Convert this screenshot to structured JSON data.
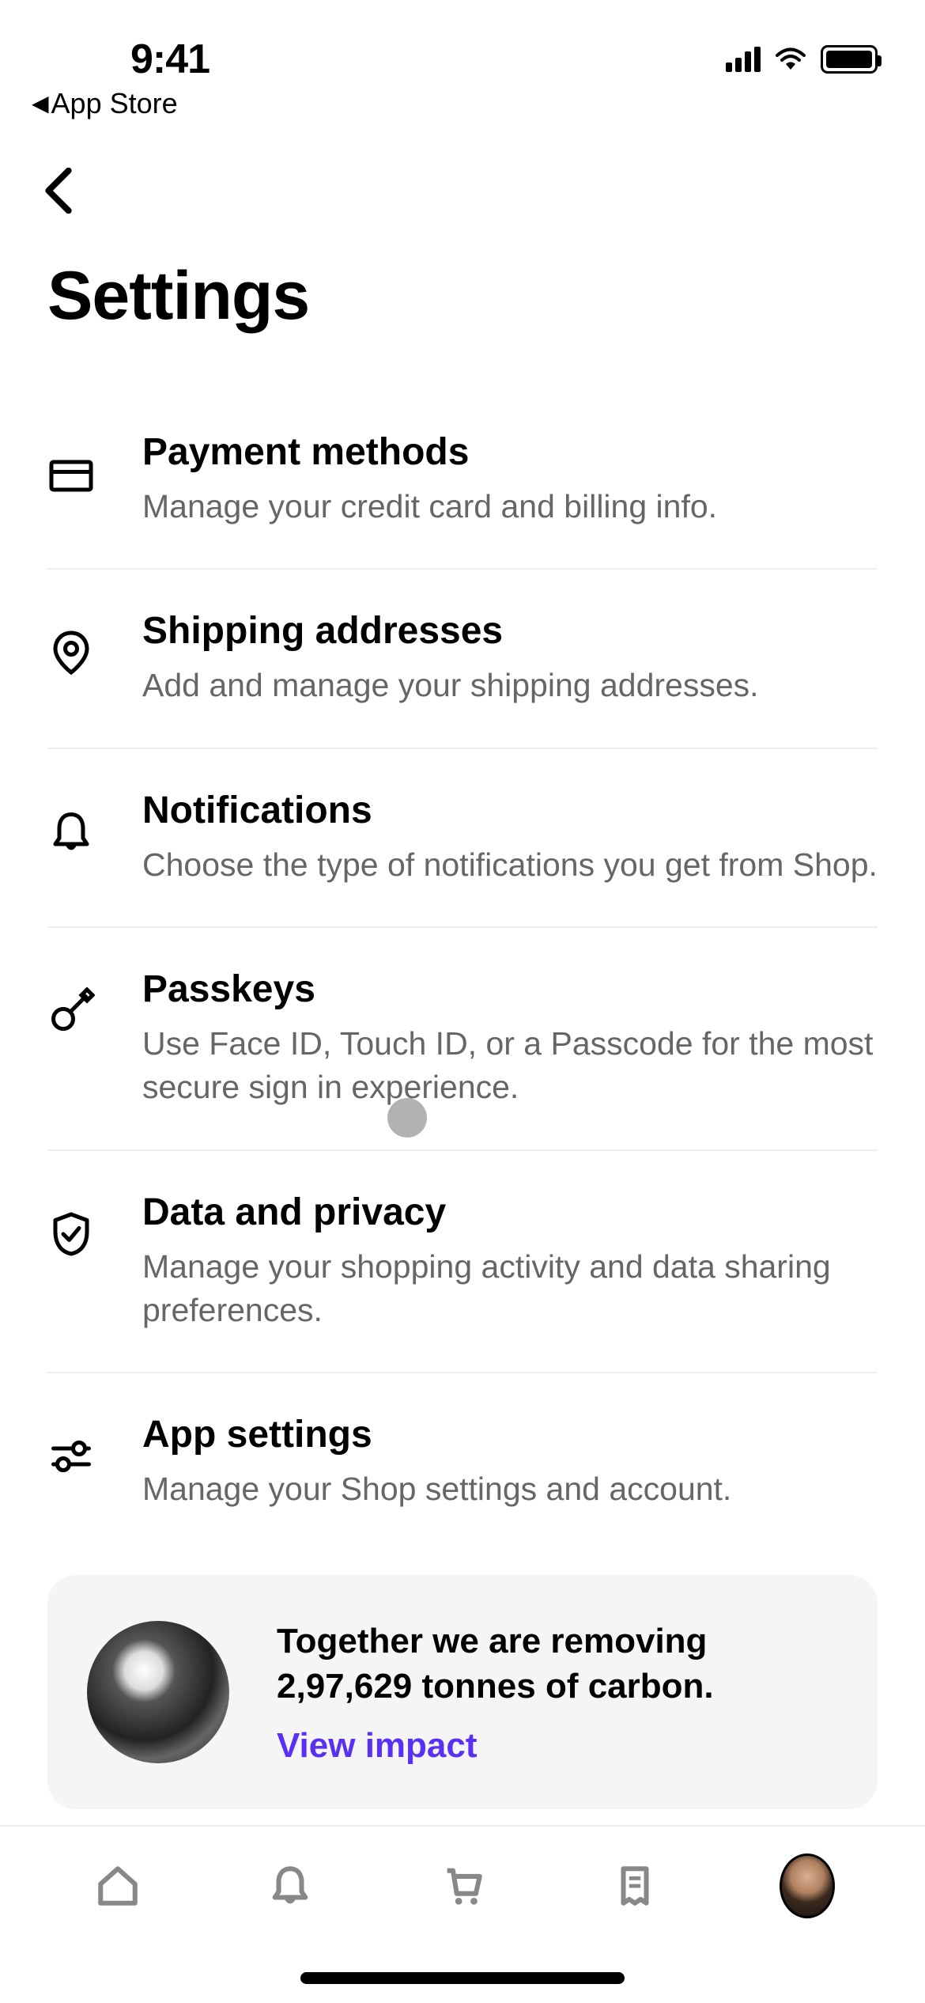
{
  "status": {
    "time": "9:41",
    "back_app": "App Store"
  },
  "page": {
    "title": "Settings"
  },
  "rows": [
    {
      "icon": "credit-card-icon",
      "title": "Payment methods",
      "sub": "Manage your credit card and billing info."
    },
    {
      "icon": "map-pin-icon",
      "title": "Shipping addresses",
      "sub": "Add and manage your shipping addresses."
    },
    {
      "icon": "bell-icon-outline",
      "title": "Notifications",
      "sub": "Choose the type of notifications you get from Shop."
    },
    {
      "icon": "key-icon",
      "title": "Passkeys",
      "sub": "Use Face ID, Touch ID, or a Passcode for the most secure sign in experience."
    },
    {
      "icon": "shield-check-icon",
      "title": "Data and privacy",
      "sub": "Manage your shopping activity and data sharing preferences."
    },
    {
      "icon": "sliders-icon",
      "title": "App settings",
      "sub": "Manage your Shop settings and account."
    }
  ],
  "impact_card": {
    "line": "Together we are removing 2,97,629 tonnes of carbon.",
    "link": "View impact"
  },
  "tabs": [
    "home",
    "notifications",
    "cart",
    "orders",
    "profile"
  ]
}
